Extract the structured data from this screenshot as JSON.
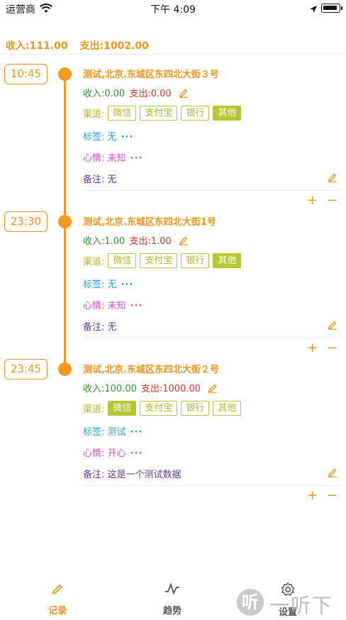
{
  "status_bar": {
    "carrier": "运营商",
    "time": "下午 4:09"
  },
  "summary": {
    "income": "收入:111.00",
    "expense": "支出:1002.00"
  },
  "colors": {
    "accent": "#f09419",
    "income": "#2a9a2a",
    "expense": "#e5302a",
    "channel": "#b3b72a",
    "tag": "#1fa0e0",
    "mood": "#d64dd8",
    "note": "#5a3c9c"
  },
  "entries": [
    {
      "time": "10:45",
      "location": "测试,北京.东城区东四北大街３号",
      "income": "收入:0.00",
      "expense": "支出:0.00",
      "channel_label": "渠道:",
      "channels": [
        "微信",
        "支付宝",
        "银行",
        "其他"
      ],
      "selected_channel": "其他",
      "tag": "标签: 无",
      "mood": "心情: 未知",
      "note": "备注: 无",
      "more": "···",
      "plus": "+",
      "minus": "−"
    },
    {
      "time": "23:30",
      "location": "测试,北京.东城区东四北大街1号",
      "income": "收入:1.00",
      "expense": "支出:1.00",
      "channel_label": "渠道:",
      "channels": [
        "微信",
        "支付宝",
        "银行",
        "其他"
      ],
      "selected_channel": "其他",
      "tag": "标签: 无",
      "mood": "心情: 未知",
      "note": "备注: 无",
      "more": "···",
      "plus": "+",
      "minus": "−"
    },
    {
      "time": "23:45",
      "location": "测试,北京.东城区东四北大街２号",
      "income": "收入:100.00",
      "expense": "支出:1000.00",
      "channel_label": "渠道:",
      "channels": [
        "微信",
        "支付宝",
        "银行",
        "其他"
      ],
      "selected_channel": "微信",
      "tag": "标签: 测试",
      "mood": "心情: 开心",
      "note": "备注: 这是一个测试数据",
      "more": "···",
      "plus": "+",
      "minus": "−"
    }
  ],
  "tabs": [
    {
      "label": "记录",
      "icon": "pencil-icon",
      "active": true
    },
    {
      "label": "趋势",
      "icon": "trend-icon",
      "active": false
    },
    {
      "label": "设置",
      "icon": "gear-icon",
      "active": false
    }
  ],
  "watermark": {
    "logo": "听",
    "text": "一听下载"
  }
}
